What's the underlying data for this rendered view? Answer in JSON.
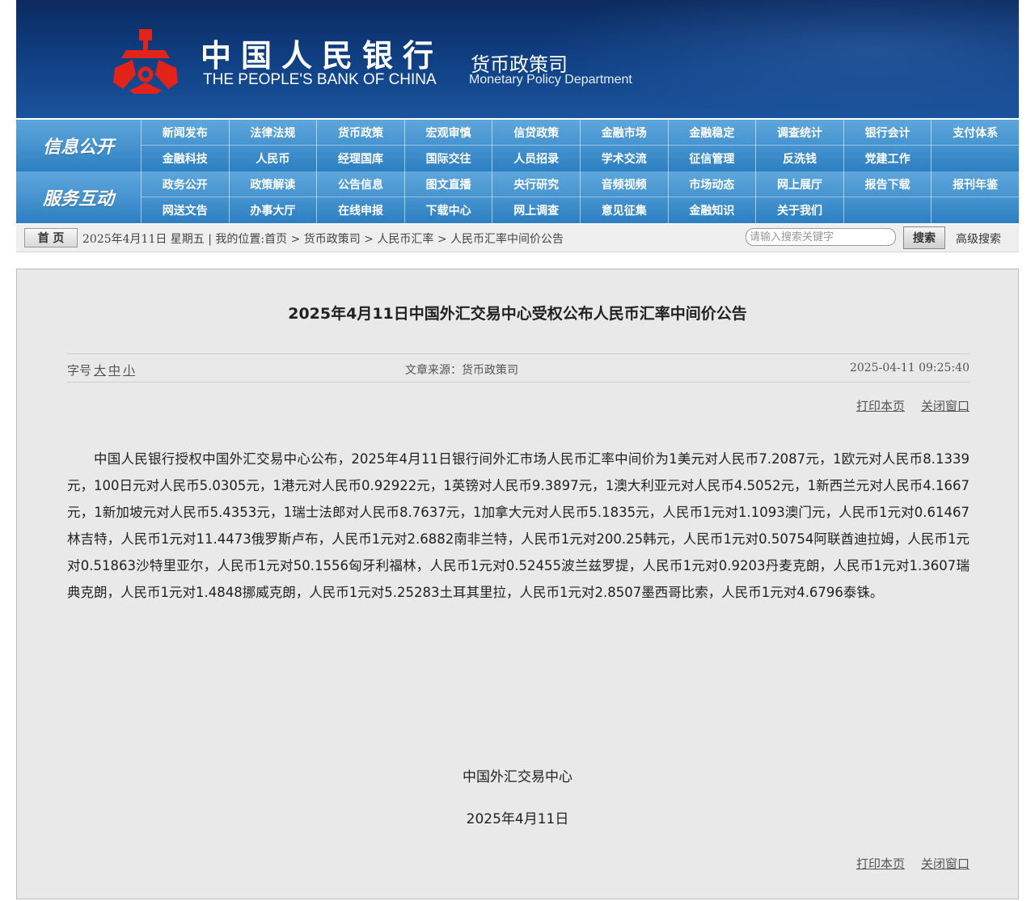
{
  "header": {
    "cn_name": "中国人民银行",
    "en_name": "THE PEOPLE'S BANK OF CHINA",
    "dept_cn": "货币政策司",
    "dept_en": "Monetary Policy Department",
    "logo_color": "#e2231a"
  },
  "nav": {
    "section1_label": "信息公开",
    "section1_items": [
      "新闻发布",
      "法律法规",
      "货币政策",
      "宏观审慎",
      "信贷政策",
      "金融市场",
      "金融稳定",
      "调查统计",
      "银行会计",
      "支付体系",
      "金融科技",
      "人民币",
      "经理国库",
      "国际交往",
      "人员招录",
      "学术交流",
      "征信管理",
      "反洗钱",
      "党建工作",
      ""
    ],
    "section2_label": "服务互动",
    "section2_items": [
      "政务公开",
      "政策解读",
      "公告信息",
      "图文直播",
      "央行研究",
      "音频视频",
      "市场动态",
      "网上展厅",
      "报告下载",
      "报刊年鉴",
      "网送文告",
      "办事大厅",
      "在线申报",
      "下载中心",
      "网上调查",
      "意见征集",
      "金融知识",
      "关于我们",
      "",
      ""
    ]
  },
  "crumbbar": {
    "home_label": "首 页",
    "text": "2025年4月11日 星期五 | 我的位置:首页 > 货币政策司 > 人民币汇率 > 人民币汇率中间价公告",
    "search_placeholder": "请输入搜索关键字",
    "search_label": "搜索",
    "advanced_label": "高级搜索"
  },
  "article": {
    "title": "2025年4月11日中国外汇交易中心受权公布人民币汇率中间价公告",
    "fontsize_label": "字号",
    "fontsize_large": "大",
    "fontsize_medium": "中",
    "fontsize_small": "小",
    "source": "文章来源：货币政策司",
    "date": "2025-04-11 09:25:40",
    "print_label": "打印本页",
    "close_label": "关闭窗口",
    "body": "中国人民银行授权中国外汇交易中心公布，2025年4月11日银行间外汇市场人民币汇率中间价为1美元对人民币7.2087元，1欧元对人民币8.1339元，100日元对人民币5.0305元，1港元对人民币0.92922元，1英镑对人民币9.3897元，1澳大利亚元对人民币4.5052元，1新西兰元对人民币4.1667元，1新加坡元对人民币5.4353元，1瑞士法郎对人民币8.7637元，1加拿大元对人民币5.1835元，人民币1元对1.1093澳门元，人民币1元对0.61467林吉特，人民币1元对11.4473俄罗斯卢布，人民币1元对2.6882南非兰特，人民币1元对200.25韩元，人民币1元对0.50754阿联酋迪拉姆，人民币1元对0.51863沙特里亚尔，人民币1元对50.1556匈牙利福林，人民币1元对0.52455波兰兹罗提，人民币1元对0.9203丹麦克朗，人民币1元对1.3607瑞典克朗，人民币1元对1.4848挪威克朗，人民币1元对5.25283土耳其里拉，人民币1元对2.8507墨西哥比索，人民币1元对4.6796泰铢。",
    "signer": "中国外汇交易中心",
    "sign_date": "2025年4月11日"
  }
}
